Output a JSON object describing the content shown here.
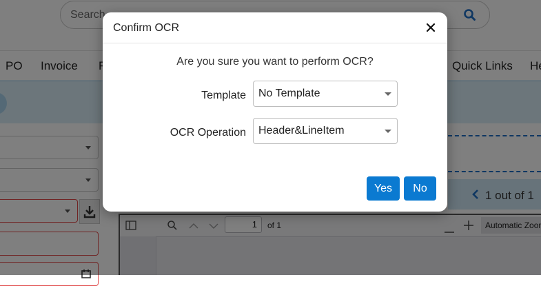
{
  "search": {
    "placeholder": "Search"
  },
  "nav": {
    "items": [
      {
        "label": "PO"
      },
      {
        "label": "Invoice"
      },
      {
        "label": "F"
      },
      {
        "label": "Quick Links"
      },
      {
        "label": "He"
      }
    ]
  },
  "pager": {
    "text": "1 out of 1"
  },
  "pdf_viewer": {
    "page_number": "1",
    "page_total": "of 1",
    "zoom": "Automatic Zoom"
  },
  "modal": {
    "title": "Confirm OCR",
    "question": "Are you sure you want to perform OCR?",
    "template_label": "Template",
    "template_value": "No Template",
    "operation_label": "OCR Operation",
    "operation_value": "Header&LineItem",
    "yes_label": "Yes",
    "no_label": "No"
  },
  "colors": {
    "primary": "#0b7ad1",
    "overlay": "rgba(0,0,0,0.5)",
    "band": "#d9ecf7",
    "error_border": "#e04848"
  }
}
